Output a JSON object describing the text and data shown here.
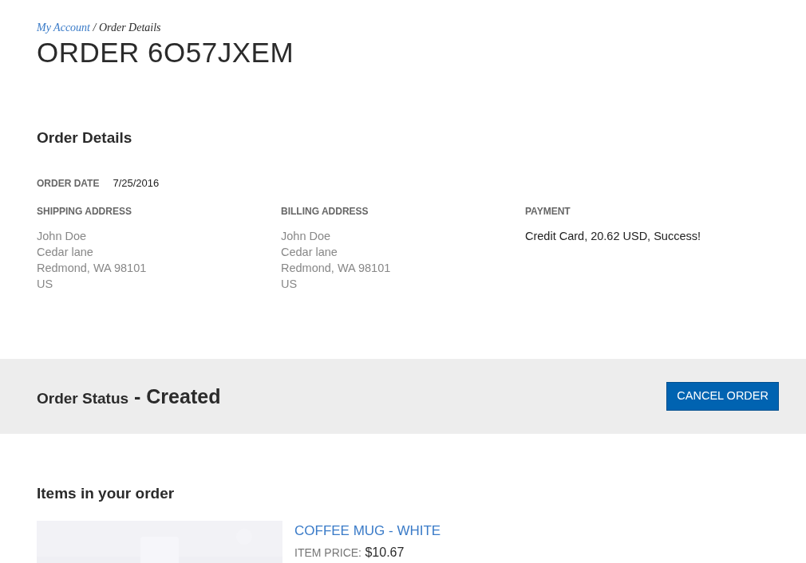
{
  "breadcrumb": {
    "link": "My Account",
    "separator": "/",
    "current": "Order Details"
  },
  "title": "ORDER 6O57JXEM",
  "details": {
    "heading": "Order Details",
    "order_date_label": "ORDER DATE",
    "order_date": "7/25/2016",
    "columns": [
      {
        "heading": "SHIPPING ADDRESS",
        "kind": "address",
        "lines": [
          "John Doe",
          "Cedar lane",
          "Redmond, WA 98101",
          "US"
        ]
      },
      {
        "heading": "BILLING ADDRESS",
        "kind": "address",
        "lines": [
          "John Doe",
          "Cedar lane",
          "Redmond, WA 98101",
          "US"
        ]
      },
      {
        "heading": "PAYMENT",
        "kind": "payment",
        "lines": [
          "Credit Card, 20.62 USD, Success!"
        ]
      }
    ]
  },
  "status": {
    "label": "Order Status",
    "separator": "-",
    "value": "Created",
    "button": "CANCEL ORDER"
  },
  "items": {
    "heading": "Items in your order",
    "list": [
      {
        "name": "COFFEE MUG - WHITE",
        "price_label": "ITEM PRICE:",
        "price": "$10.67",
        "kind": "picture"
      }
    ]
  }
}
